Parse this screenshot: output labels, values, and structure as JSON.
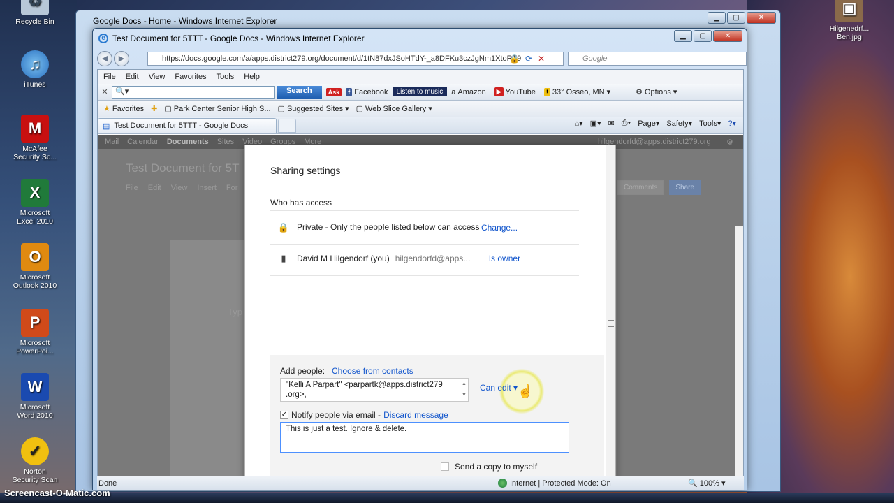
{
  "desktop": {
    "icons": [
      {
        "label": "Recycle Bin",
        "icon": "recycle-bin-icon"
      },
      {
        "label": "iTunes",
        "icon": "itunes-icon"
      },
      {
        "label": "McAfee\nSecurity Sc...",
        "icon": "mcafee-icon"
      },
      {
        "label": "Microsoft\nExcel 2010",
        "icon": "excel-icon"
      },
      {
        "label": "Microsoft\nOutlook 2010",
        "icon": "outlook-icon"
      },
      {
        "label": "Microsoft\nPowerPoi...",
        "icon": "powerpoint-icon"
      },
      {
        "label": "Microsoft\nWord 2010",
        "icon": "word-icon"
      },
      {
        "label": "Norton\nSecurity Scan",
        "icon": "norton-icon"
      }
    ],
    "right_icon": "Hilgenedrf...\nBen.jpg",
    "watermark": "Screencast-O-Matic.com"
  },
  "bg_window": {
    "title": "Google Docs - Home - Windows Internet Explorer"
  },
  "window": {
    "title": "Test Document for 5TTT - Google Docs - Windows Internet Explorer",
    "address": "https://docs.google.com/a/apps.district279.org/document/d/1tN87dxJSoHTdY-_a8DFKu3czJgNm1XtoRT9",
    "search_placeholder": "Google",
    "menu": [
      "File",
      "Edit",
      "View",
      "Favorites",
      "Tools",
      "Help"
    ],
    "toolbar": {
      "search_button": "Search",
      "facebook": "Facebook",
      "listen": "Listen to music",
      "amazon": "Amazon",
      "youtube": "YouTube",
      "weather": "33° Osseo, MN",
      "options": "Options"
    },
    "favorites": {
      "label": "Favorites",
      "items": [
        "Park Center Senior High S...",
        "Suggested Sites",
        "Web Slice Gallery"
      ]
    },
    "tab": "Test Document for 5TTT - Google Docs",
    "command": [
      "Page",
      "Safety",
      "Tools"
    ],
    "status": {
      "left": "Done",
      "zone": "Internet | Protected Mode: On",
      "zoom": "100%"
    }
  },
  "docs": {
    "gbar": [
      "Mail",
      "Calendar",
      "Documents",
      "Sites",
      "Video",
      "Groups",
      "More"
    ],
    "gbar_active": "Documents",
    "gbar_user": "hilgendorfd@apps.district279.org",
    "title": "Test Document for 5T",
    "menu": [
      "File",
      "Edit",
      "View",
      "Insert",
      "For"
    ],
    "comments": "Comments",
    "share": "Share",
    "type_hint": "Typ"
  },
  "sharing": {
    "title": "Sharing settings",
    "who_has_access": "Who has access",
    "rows": [
      {
        "icon": "lock-icon",
        "text": "Private - Only the people listed below can access",
        "email": "",
        "action": "Change..."
      },
      {
        "icon": "person-icon",
        "text": "David M Hilgendorf (you)",
        "email": "hilgendorfd@apps...",
        "action": "Is owner"
      }
    ],
    "add_people_label": "Add people:",
    "choose_contacts": "Choose from contacts",
    "people_value": "\"Kelli A Parpart\" <parpartk@apps.district279 .org>,",
    "permission": "Can edit",
    "notify_label": "Notify people via email -",
    "discard": "Discard message",
    "message": "This is just a test. Ignore & delete.",
    "send_copy": "Send a copy to myself"
  }
}
